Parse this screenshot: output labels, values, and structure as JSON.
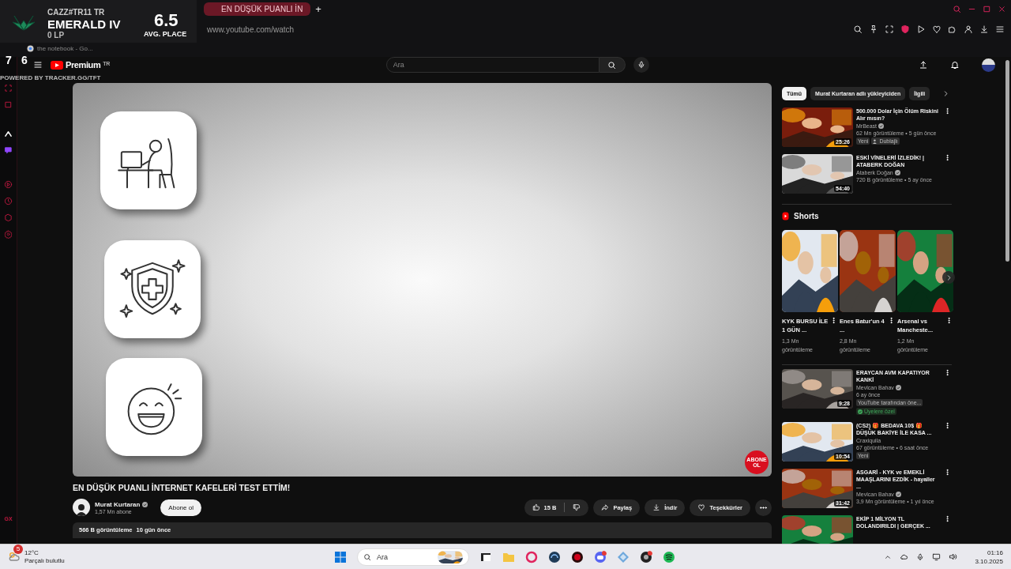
{
  "browser": {
    "tab": {
      "title": "EN DÜŞÜK PUANLI İN",
      "selected": true
    },
    "new_tab": "+",
    "address": "www.youtube.com/watch",
    "bookmark": "the notebook - Go..."
  },
  "tft_overlay": {
    "player": "CAZZ#TR11 TR",
    "rank": "EMERALD IV",
    "lp": "0 LP",
    "avg": "6.5",
    "avg_label": "AVG. PLACE",
    "counts": [
      "7",
      "6"
    ],
    "credit": "POWERED BY TRACKER.GG/TFT"
  },
  "sidebar": {
    "footer": "GX"
  },
  "masthead": {
    "logo": "Premium",
    "region": "TR",
    "search": {
      "placeholder": "Ara"
    }
  },
  "player": {
    "subscribe_badge": "ABONE OL"
  },
  "video": {
    "title": "EN DÜŞÜK PUANLI İNTERNET KAFELERİ TEST ETTİM!",
    "channel": "Murat Kurtaran",
    "verified": true,
    "subscribers": "1,57 Mn abone",
    "subscribe": "Abone ol",
    "actions": [
      {
        "kind": "like",
        "label": "15 B"
      },
      {
        "kind": "share",
        "label": "Paylaş"
      },
      {
        "kind": "download",
        "label": "İndir"
      },
      {
        "kind": "thanks",
        "label": "Teşekkürler"
      },
      {
        "kind": "more"
      }
    ],
    "views": "566 B görüntüleme",
    "date": "10 gün önce"
  },
  "chips": [
    {
      "label": "Tümü",
      "selected": true
    },
    {
      "label": "Murat Kurtaran adlı yükleyiciden",
      "selected": false
    },
    {
      "label": "İlgili",
      "selected": false
    }
  ],
  "recommendations": [
    {
      "title": "500.000 Dolar İçin Ölüm Riskini Alır mısın?",
      "channel": "MrBeast",
      "verified": true,
      "meta": "62 Mn görüntüleme • 5 gün önce",
      "duration": "25:26",
      "badges": [
        {
          "kind": "plain",
          "text": "Yeni"
        },
        {
          "kind": "dubbed",
          "text": "Dublajlı"
        }
      ]
    },
    {
      "title": "ESKİ VİNELERİ İZLEDİK! | ATABERK DOĞAN",
      "channel": "Ataberk Doğan",
      "verified": true,
      "meta": "720 B görüntüleme • 5 ay önce",
      "duration": "54:40"
    }
  ],
  "shorts": {
    "title": "Shorts",
    "items": [
      {
        "title": "KYK BURSU İLE 1 GÜN ...",
        "views": "1,3 Mn görüntüleme"
      },
      {
        "title": "Enes Batur'un 4 ...",
        "views": "2,8 Mn görüntüleme"
      },
      {
        "title": "Arsenal vs Mancheste...",
        "views": "1,2 Mn görüntüleme"
      }
    ]
  },
  "more_recommendations": [
    {
      "title": "ERAYCAN AVM KAPATIYOR KANKİ",
      "channel": "Mevlcan Bahav",
      "verified": true,
      "meta": "6 ay önce",
      "duration": "9:28",
      "badges": [
        {
          "kind": "plain",
          "text": "YouTube tarafından öne..."
        },
        {
          "kind": "members",
          "text": "Üyelere özel"
        }
      ]
    },
    {
      "title": "(CS2) 🎁 BEDAVA 10$ 🎁 DÜŞÜK BAKİYE İLE KASA ...",
      "channel": "Craxiquila",
      "verified": false,
      "meta": "67 görüntüleme • 6 saat önce",
      "duration": "10:54",
      "badges": [
        {
          "kind": "plain",
          "text": "Yeni"
        }
      ]
    },
    {
      "title": "ASGARİ - KYK ve EMEKLİ MAAŞLARINI EZDİK - hayaller ...",
      "channel": "Mevlcan Bahav",
      "verified": true,
      "meta": "3,9 Mn görüntüleme • 1 yıl önce",
      "duration": "31:42"
    },
    {
      "title": "EKİP 1 MİLYON TL DOLANDIRILDI | GERÇEK ..."
    }
  ],
  "taskbar": {
    "weather": {
      "temp": "12°C",
      "desc": "Parçalı bulutlu",
      "badge": "5"
    },
    "search": {
      "placeholder": "Ara"
    },
    "clock": {
      "time": "01:16",
      "date": "3.10.2025"
    }
  }
}
